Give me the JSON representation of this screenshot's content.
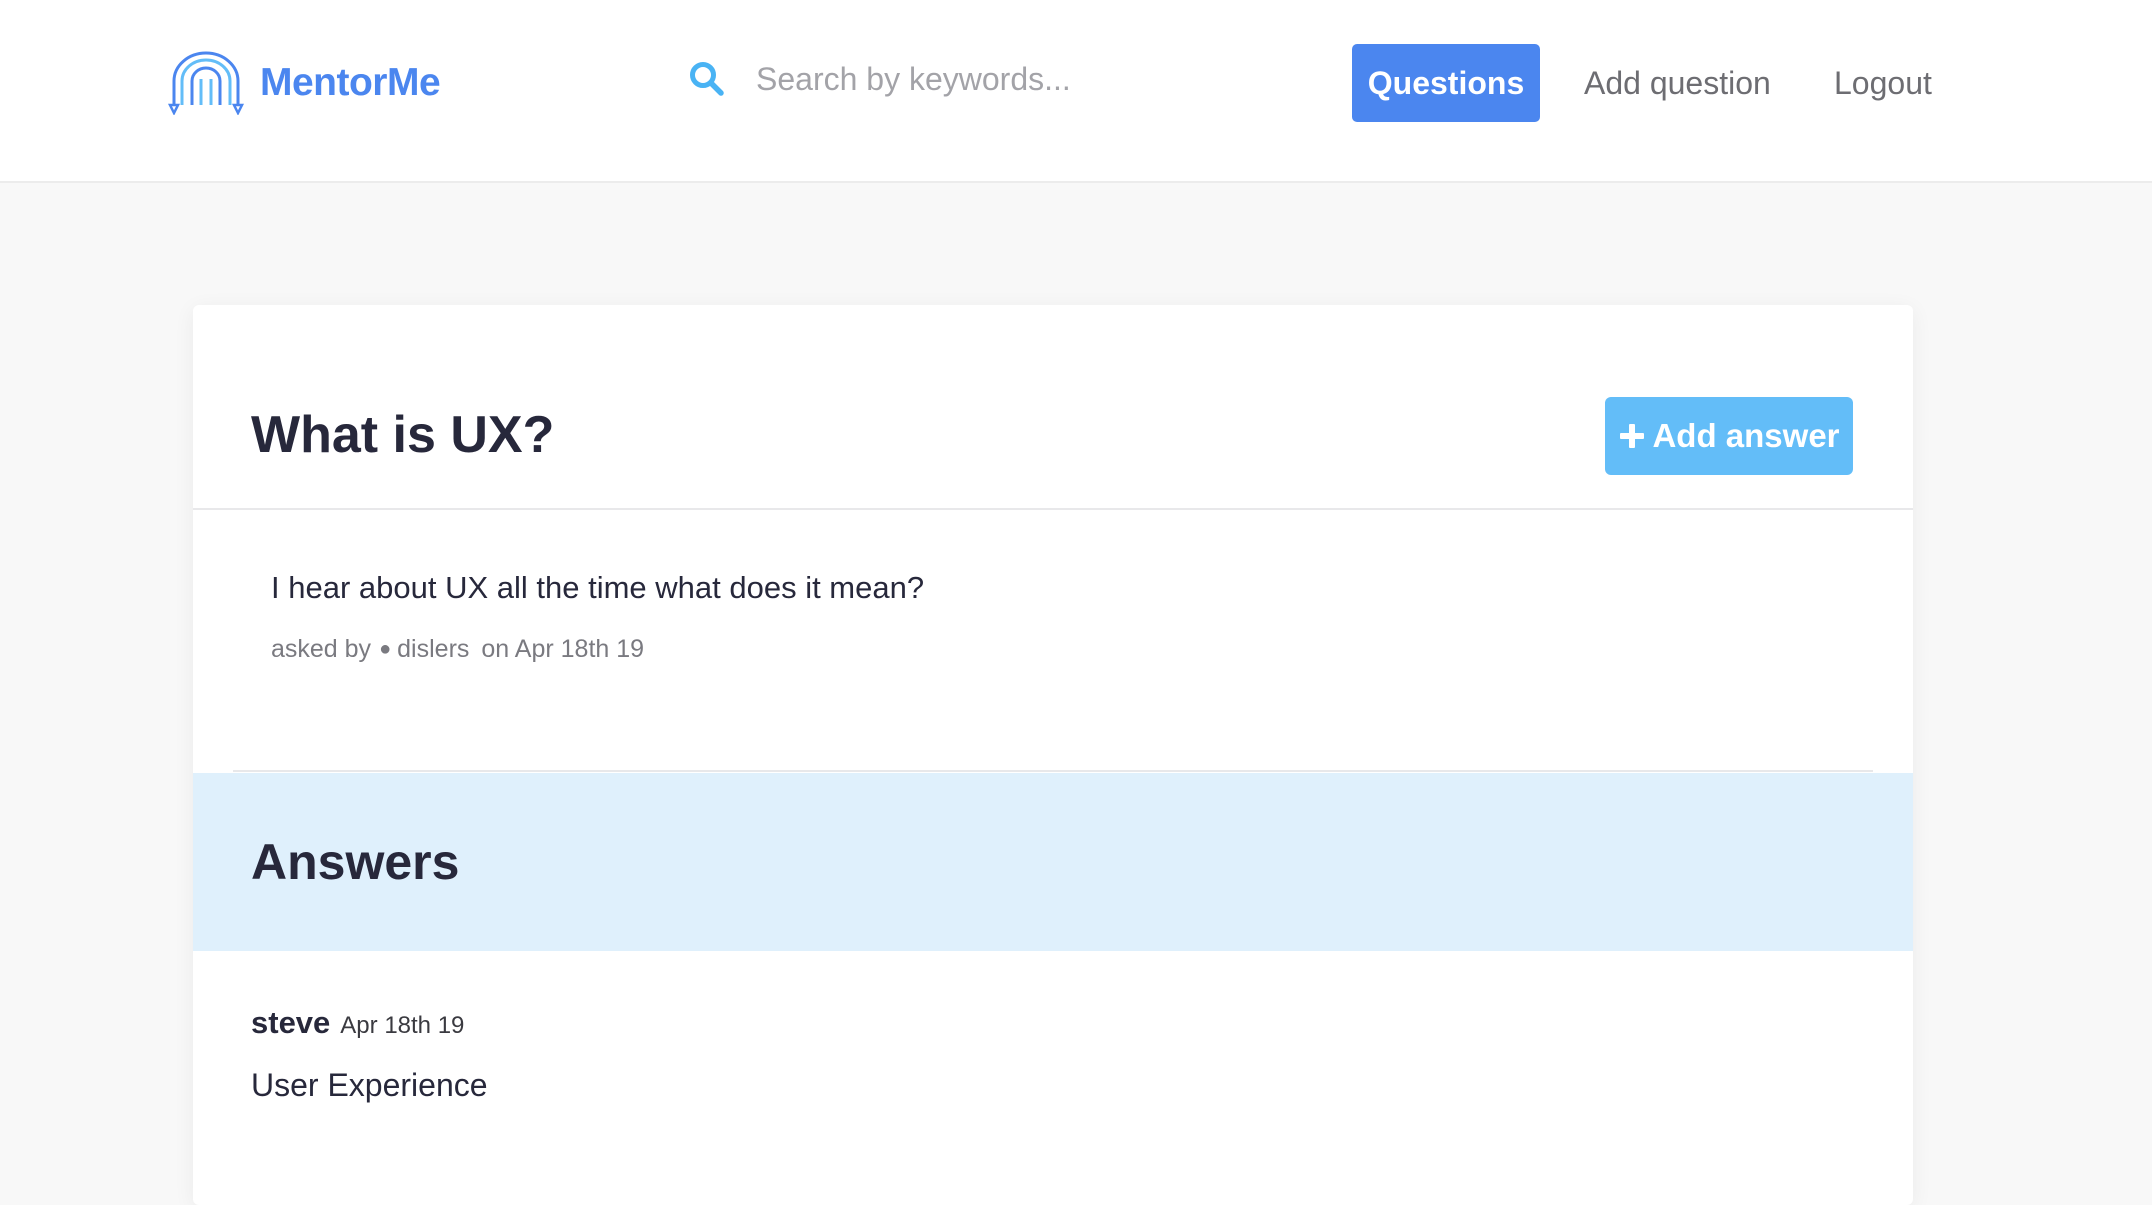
{
  "header": {
    "logo_text": "MentorMe",
    "search_placeholder": "Search by keywords...",
    "nav": {
      "questions": "Questions",
      "add_question": "Add question",
      "logout": "Logout"
    },
    "colors": {
      "brand": "#4b86ef",
      "accent": "#63bdf8"
    }
  },
  "question": {
    "title": "What is UX?",
    "add_answer_label": "Add answer",
    "body": "I hear about UX all the time what does it mean?",
    "meta": {
      "asked_by_label": "asked by",
      "author": "dislers",
      "date": "on Apr 18th 19"
    }
  },
  "answers": {
    "heading": "Answers",
    "items": [
      {
        "author": "steve",
        "date": "Apr 18th 19",
        "body": "User Experience"
      }
    ]
  }
}
